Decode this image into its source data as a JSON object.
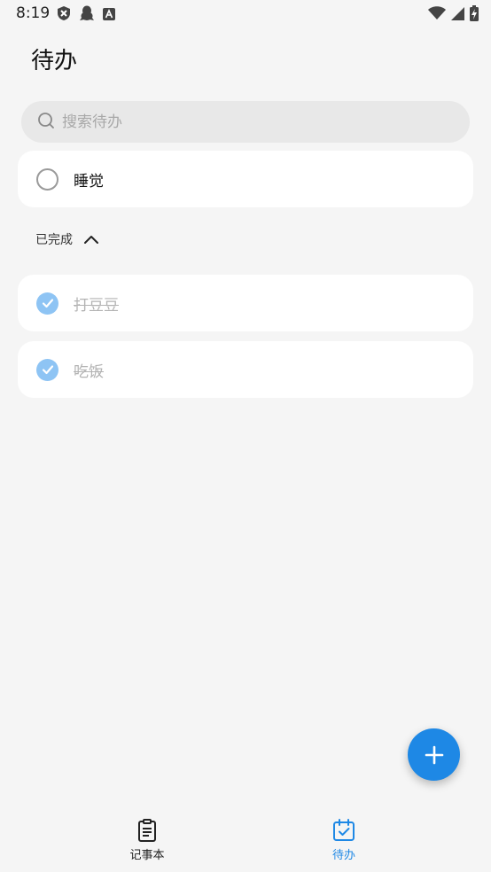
{
  "status_bar": {
    "time": "8:19"
  },
  "header": {
    "title": "待办"
  },
  "search": {
    "placeholder": "搜索待办",
    "value": ""
  },
  "todos": [
    {
      "label": "睡觉",
      "done": false
    }
  ],
  "completed_section": {
    "label": "已完成",
    "expanded": true,
    "items": [
      {
        "label": "打豆豆",
        "done": true
      },
      {
        "label": "吃饭",
        "done": true
      }
    ]
  },
  "bottom_nav": {
    "items": [
      {
        "label": "记事本",
        "icon": "notepad-icon",
        "active": false
      },
      {
        "label": "待办",
        "icon": "calendar-check-icon",
        "active": true
      }
    ]
  },
  "colors": {
    "accent": "#1e88e5",
    "checked": "#8ec4f4",
    "background": "#f5f5f5",
    "card": "#ffffff",
    "search_bg": "#e8e8e8"
  }
}
